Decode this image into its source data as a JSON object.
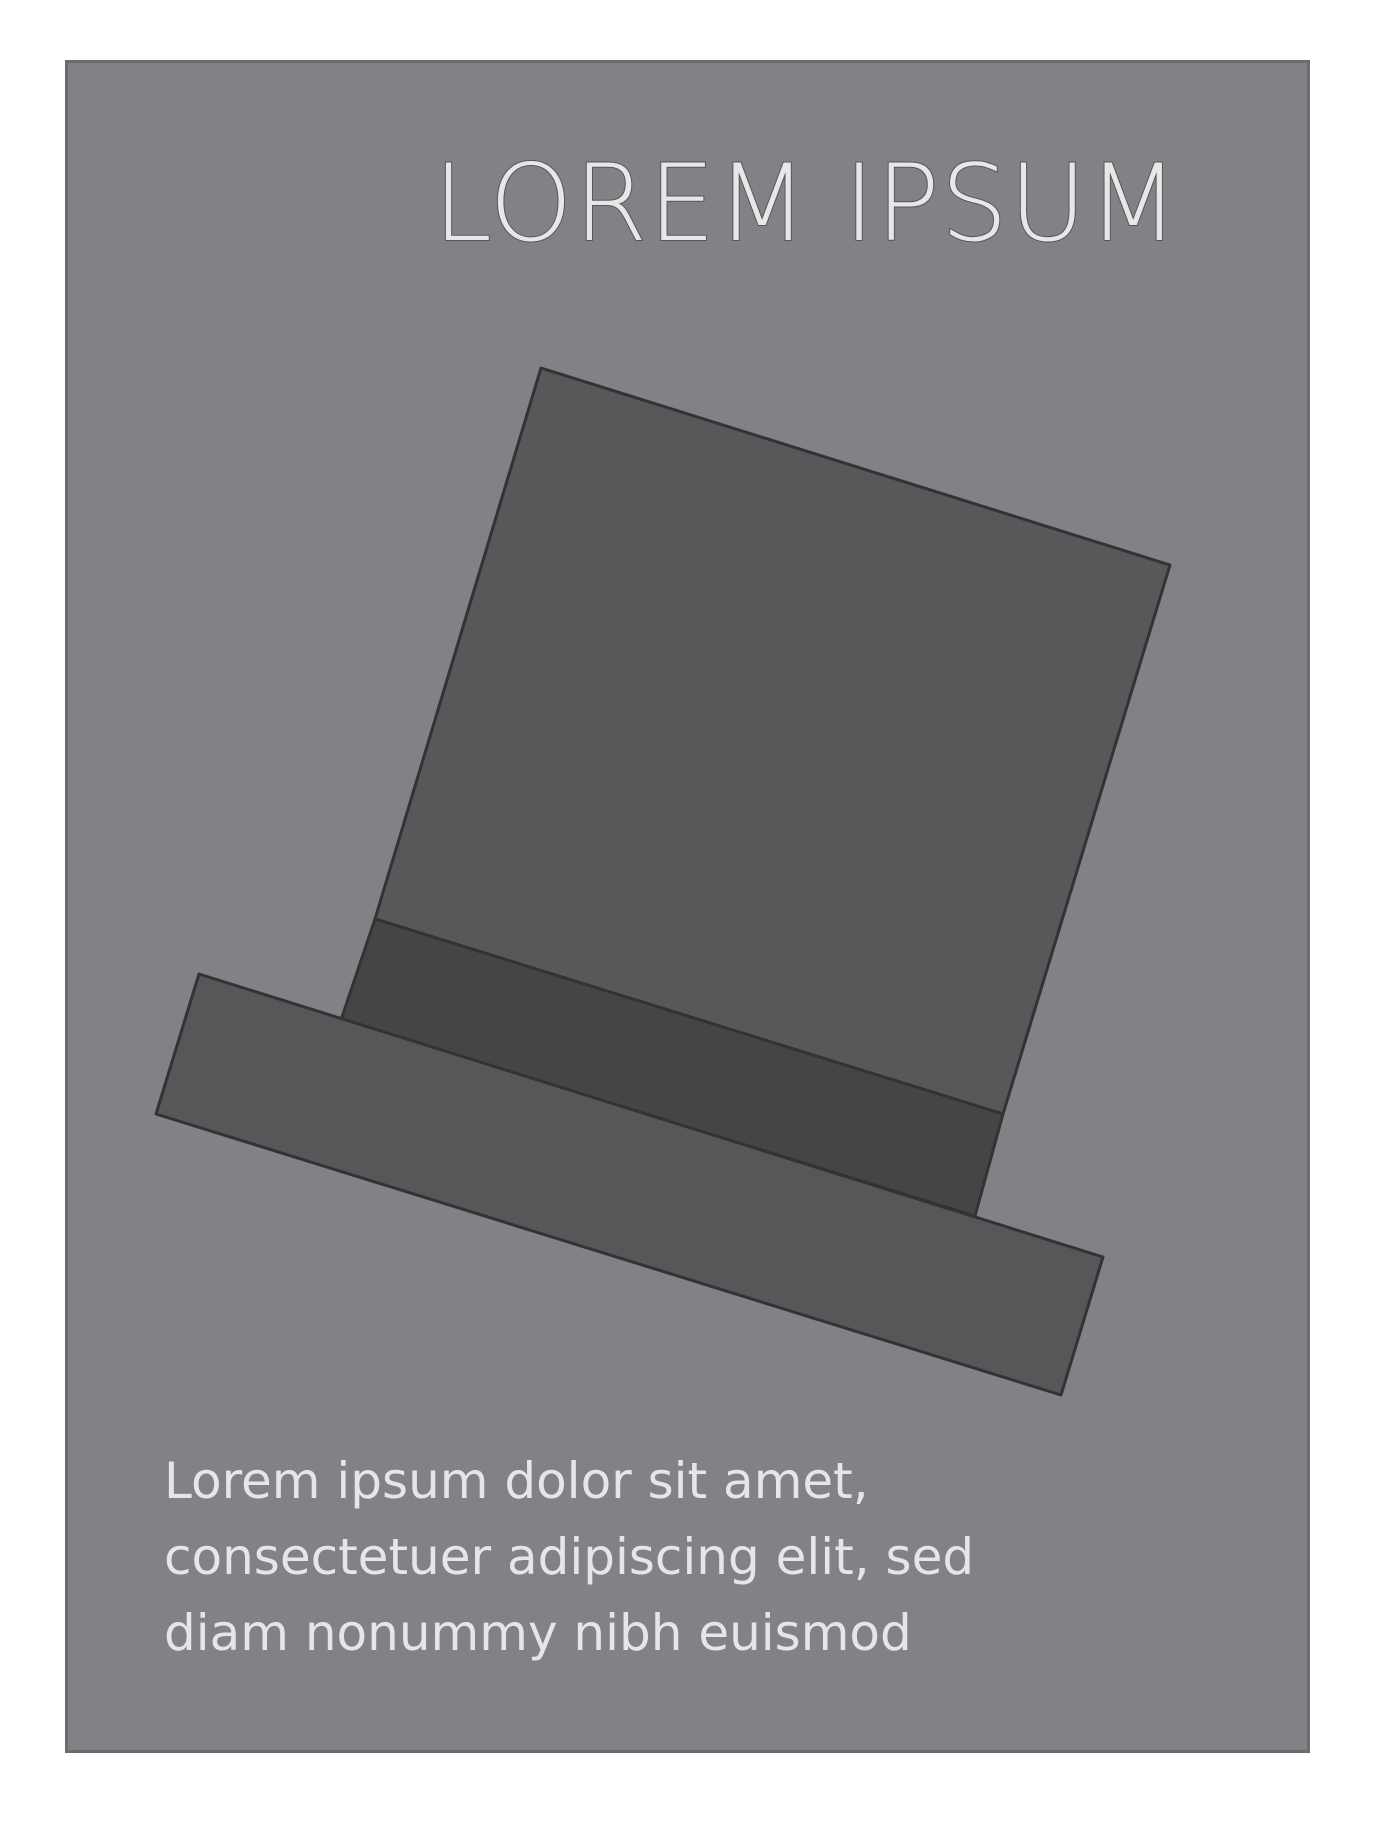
{
  "poster": {
    "title": "LOREM IPSUM",
    "body_lines": [
      "Lorem ipsum dolor sit amet,",
      "consectetuer adipiscing elit, sed",
      "diam nonummy nibh euismod"
    ],
    "illustration": "top-hat-icon",
    "colors": {
      "background": "#818285",
      "frame": "#6b6c6f",
      "hat": "#58585a",
      "hat_band": "#444645",
      "outline": "#333335",
      "text": "#e7e7e8"
    }
  }
}
